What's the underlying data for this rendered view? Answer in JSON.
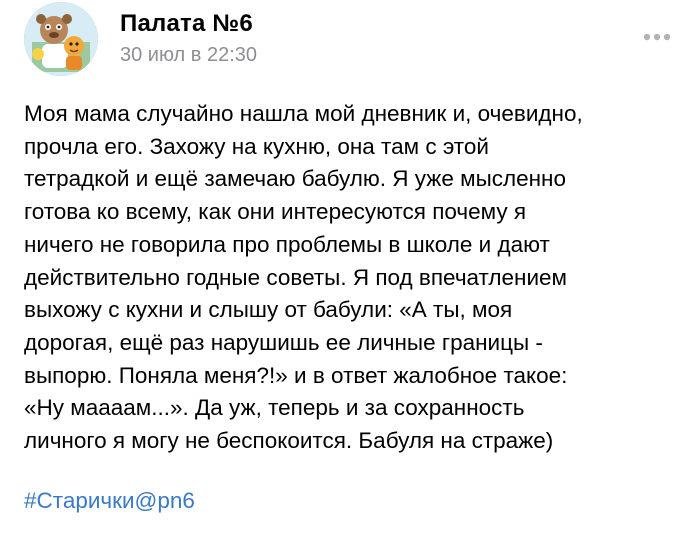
{
  "post": {
    "group_name": "Палата №6",
    "date": "30 июл в 22:30",
    "avatar_icon": "group-avatar-cartoon",
    "more_icon": "more-dots-icon",
    "text": "Моя мама случайно нашла мой дневник и, очевидно,\nпрочла его. Захожу на кухню, она там с этой\nтетрадкой и ещё замечаю бабулю. Я уже мысленно\nготова ко всему, как они интересуются почему я\nничего не говорила про проблемы в школе и дают\nдействительно годные советы. Я под впечатлением\nвыхожу с кухни и слышу от бабули: «А ты, моя\nдорогая, ещё раз нарушишь ее личные границы -\nвыпорю. Поняла меня?!» и в ответ жалобное такое:\n«Ну маааам...». Да уж, теперь и за сохранность\nличного я могу не беспокоится. Бабуля на страже)",
    "hashtag": "#Старички@pn6"
  },
  "colors": {
    "secondary_text": "#8e8e93",
    "link": "#3a79c6",
    "avatar_ring": "#6ab0d6"
  }
}
